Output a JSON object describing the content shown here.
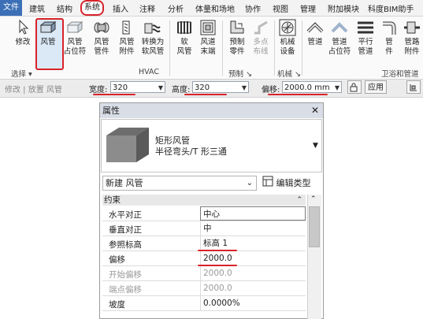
{
  "menubar": {
    "items": [
      "文件",
      "建筑",
      "结构",
      "系统",
      "插入",
      "注释",
      "分析",
      "体量和场地",
      "协作",
      "视图",
      "管理",
      "附加模块",
      "科度BIM助手"
    ]
  },
  "ribbon": {
    "buttons": [
      {
        "id": "modify",
        "label": "修改"
      },
      {
        "id": "duct",
        "label": "风管"
      },
      {
        "id": "duct-placeholder",
        "label": "风管\n占位符"
      },
      {
        "id": "duct-fitting",
        "label": "风管\n管件"
      },
      {
        "id": "duct-accessory",
        "label": "风管\n附件"
      },
      {
        "id": "convert-flex",
        "label": "转换为\n软风管"
      },
      {
        "id": "flex-duct",
        "label": "软\n风管"
      },
      {
        "id": "air-terminal",
        "label": "风道\n末端"
      },
      {
        "id": "fabrication-part",
        "label": "预制\n零件"
      },
      {
        "id": "multipoint-routing",
        "label": "多点\n布线"
      },
      {
        "id": "mechanical-equipment",
        "label": "机械\n设备"
      },
      {
        "id": "pipe",
        "label": "管道"
      },
      {
        "id": "pipe-placeholder",
        "label": "管道\n占位符"
      },
      {
        "id": "parallel-pipes",
        "label": "平行\n管道"
      },
      {
        "id": "pipe-fitting",
        "label": "管\n件"
      },
      {
        "id": "pipe-accessory",
        "label": "管路\n附件"
      }
    ],
    "groups": {
      "select": "选择 ▾",
      "hvac": "HVAC",
      "fabrication": "预制 ↘",
      "mechanical": "机械 ↘",
      "plumbing": "卫浴和管道"
    }
  },
  "optionsbar": {
    "context": "修改 | 放置 风管",
    "width_label": "宽度:",
    "width_value": "320",
    "height_label": "高度:",
    "height_value": "320",
    "offset_label": "偏移:",
    "offset_value": "2000.0 mm",
    "apply_label": "应用"
  },
  "properties": {
    "title": "属性",
    "close": "✕",
    "type_name": "矩形风管",
    "type_sub": "半径弯头/T 形三通",
    "new_label": "新建 风管",
    "edit_type_label": "编辑类型",
    "category": "约束",
    "rows": [
      {
        "name": "水平对正",
        "value": "中心"
      },
      {
        "name": "垂直对正",
        "value": "中"
      },
      {
        "name": "参照标高",
        "value": "标高 1"
      },
      {
        "name": "偏移",
        "value": "2000.0"
      },
      {
        "name": "开始偏移",
        "value": "2000.0"
      },
      {
        "name": "端点偏移",
        "value": "2000.0"
      },
      {
        "name": "坡度",
        "value": "0.0000%"
      }
    ]
  },
  "colors": {
    "highlight_red": "#d8232a",
    "ribbon_blue": "#3b6fb6"
  }
}
